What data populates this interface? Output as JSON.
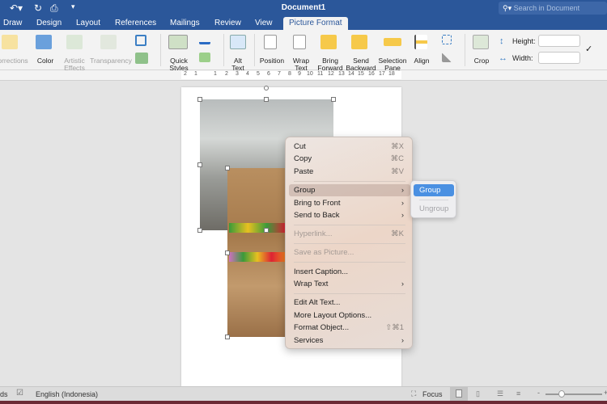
{
  "window": {
    "title": "Document1",
    "search_placeholder": "Search in Document"
  },
  "tabs": [
    {
      "label": "Draw"
    },
    {
      "label": "Design"
    },
    {
      "label": "Layout"
    },
    {
      "label": "References"
    },
    {
      "label": "Mailings"
    },
    {
      "label": "Review"
    },
    {
      "label": "View"
    },
    {
      "label": "Picture Format",
      "active": true
    }
  ],
  "ribbon": {
    "corrections": "orrections",
    "color": "Color",
    "artistic_effects": "Artistic Effects",
    "transparency": "Transparency",
    "quick_styles": "Quick Styles",
    "alt_text": "Alt Text",
    "position": "Position",
    "wrap_text": "Wrap Text",
    "bring_forward": "Bring Forward",
    "send_backward": "Send Backward",
    "selection_pane": "Selection Pane",
    "align": "Align",
    "crop": "Crop",
    "height_label": "Height:",
    "width_label": "Width:",
    "height_value": "",
    "width_value": ""
  },
  "ruler": {
    "ticks": [
      "2",
      "1",
      "1",
      "2",
      "3",
      "4",
      "5",
      "6",
      "7",
      "8",
      "9",
      "10",
      "11",
      "12",
      "13",
      "14",
      "15",
      "16",
      "17",
      "18"
    ]
  },
  "context_menu": {
    "cut": "Cut",
    "cut_sc": "⌘X",
    "copy": "Copy",
    "copy_sc": "⌘C",
    "paste": "Paste",
    "paste_sc": "⌘V",
    "group": "Group",
    "bring_to_front": "Bring to Front",
    "send_to_back": "Send to Back",
    "hyperlink": "Hyperlink...",
    "hyperlink_sc": "⌘K",
    "save_as_picture": "Save as Picture...",
    "insert_caption": "Insert Caption...",
    "wrap_text": "Wrap Text",
    "edit_alt_text": "Edit Alt Text...",
    "more_layout": "More Layout Options...",
    "format_object": "Format Object...",
    "format_object_sc": "⇧⌘1",
    "services": "Services"
  },
  "submenu": {
    "group": "Group",
    "ungroup": "Ungroup"
  },
  "status": {
    "words": "ds",
    "language": "English (Indonesia)",
    "focus": "Focus"
  },
  "colors": {
    "brand": "#2b579a",
    "highlight": "#4a90e2"
  }
}
